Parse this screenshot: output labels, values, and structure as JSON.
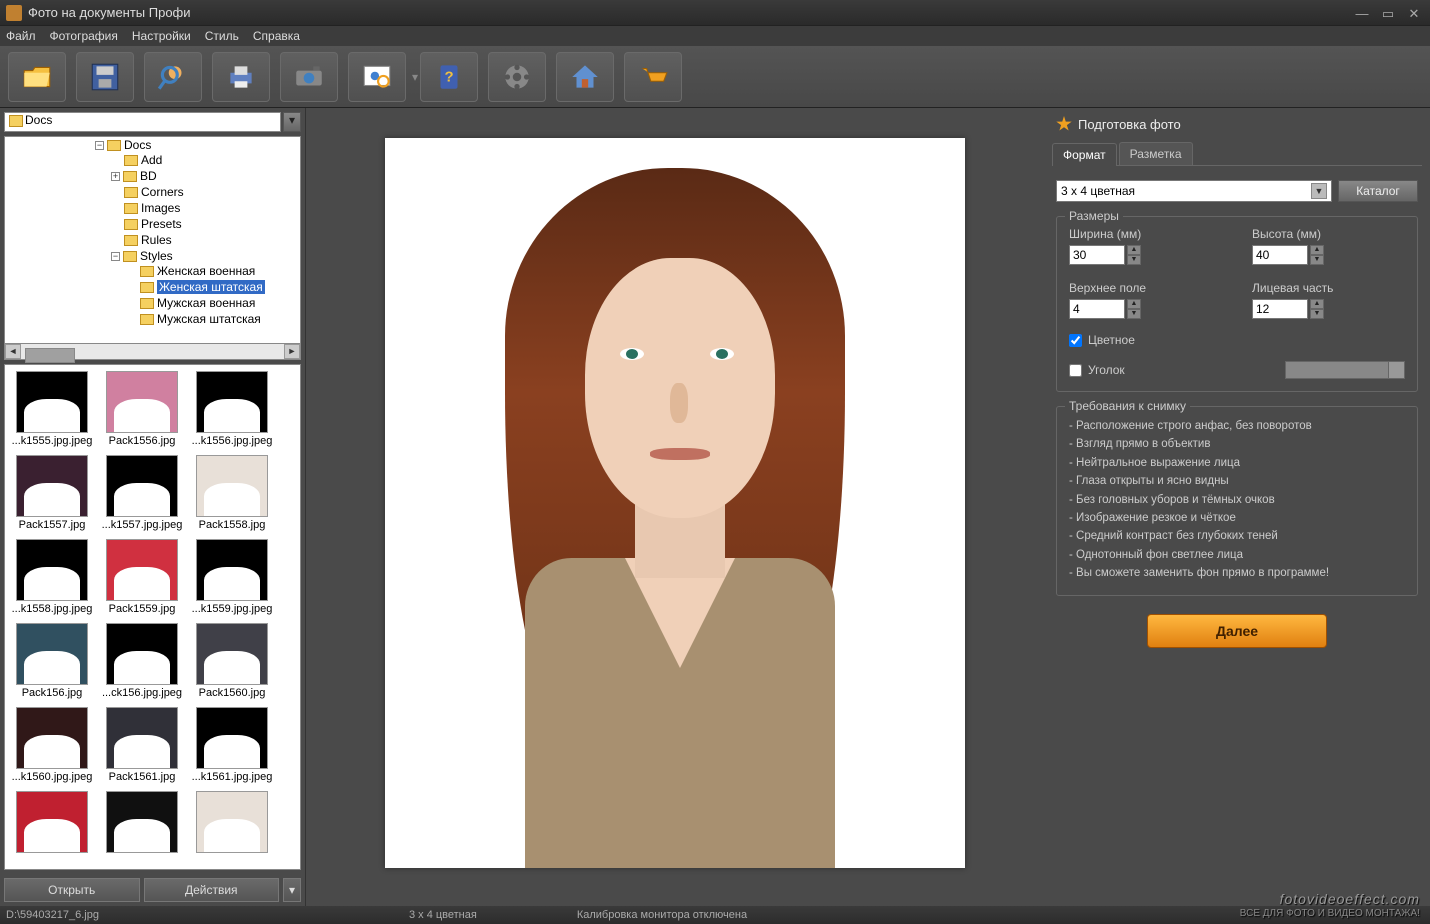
{
  "window": {
    "title": "Фото на документы Профи"
  },
  "menu": [
    "Файл",
    "Фотография",
    "Настройки",
    "Стиль",
    "Справка"
  ],
  "toolbar_icons": [
    "open-folder-icon",
    "save-icon",
    "preview-icon",
    "print-icon",
    "camera-icon",
    "fit-screen-icon",
    "help-book-icon",
    "video-icon",
    "home-icon",
    "shop-cart-icon"
  ],
  "path": {
    "value": "Docs"
  },
  "tree": {
    "root": "Docs",
    "children": [
      "Add",
      "BD",
      "Corners",
      "Images",
      "Presets",
      "Rules"
    ],
    "styles_label": "Styles",
    "styles": [
      "Женская военная",
      "Женская штатская",
      "Мужская военная",
      "Мужская штатская"
    ],
    "selected_index": 1
  },
  "thumbs": [
    "...k1555.jpg.jpeg",
    "Pack1556.jpg",
    "...k1556.jpg.jpeg",
    "Pack1557.jpg",
    "...k1557.jpg.jpeg",
    "Pack1558.jpg",
    "...k1558.jpg.jpeg",
    "Pack1559.jpg",
    "...k1559.jpg.jpeg",
    "Pack156.jpg",
    "...ck156.jpg.jpeg",
    "Pack1560.jpg",
    "...k1560.jpg.jpeg",
    "Pack1561.jpg",
    "...k1561.jpg.jpeg",
    "",
    "",
    ""
  ],
  "left_buttons": {
    "open": "Открыть",
    "actions": "Действия"
  },
  "right": {
    "header": "Подготовка фото",
    "tabs": {
      "format": "Формат",
      "markup": "Разметка"
    },
    "format_combo": "3 x 4 цветная",
    "catalog_btn": "Каталог",
    "sizes_group": "Размеры",
    "width_label": "Ширина (мм)",
    "height_label": "Высота (мм)",
    "top_label": "Верхнее поле",
    "face_label": "Лицевая часть",
    "width_val": "30",
    "height_val": "40",
    "top_val": "4",
    "face_val": "12",
    "color_cb": "Цветное",
    "corner_cb": "Уголок",
    "req_group": "Требования к снимку",
    "requirements": [
      "Расположение строго анфас, без поворотов",
      "Взгляд прямо в объектив",
      "Нейтральное выражение лица",
      "Глаза открыты и ясно видны",
      "Без головных уборов и тёмных очков",
      "Изображение резкое и чёткое",
      "Средний контраст без глубоких теней",
      "Однотонный фон светлее лица",
      "Вы сможете заменить фон прямо в программе!"
    ],
    "next_btn": "Далее"
  },
  "status": {
    "path": "D:\\59403217_6.jpg",
    "format": "3 x 4 цветная",
    "calib": "Калибровка монитора отключена"
  },
  "watermark": {
    "site": "fotovideoeffect.com",
    "sub": "ВСЕ ДЛЯ ФОТО И ВИДЕО МОНТАЖА!"
  }
}
